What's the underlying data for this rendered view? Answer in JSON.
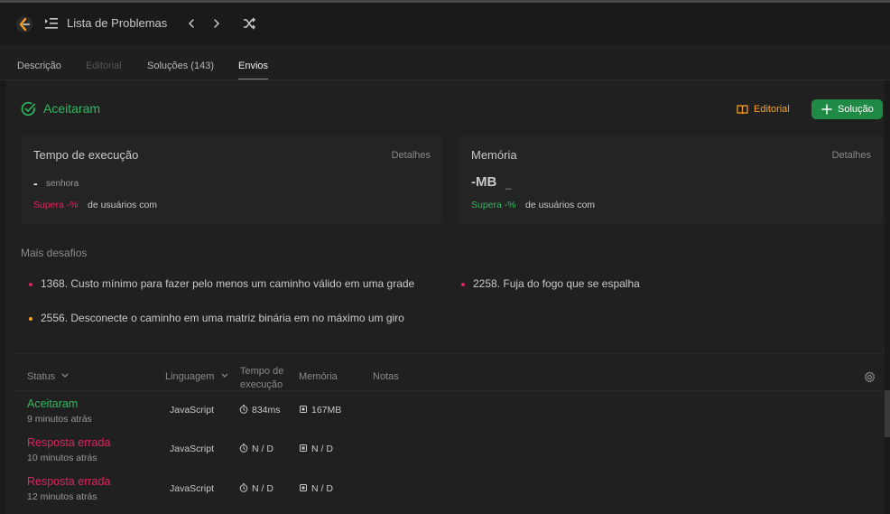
{
  "header": {
    "list_title": "Lista de Problemas",
    "icons": [
      "logo-icon",
      "list-icon",
      "chevron-left-icon",
      "chevron-right-icon",
      "shuffle-icon"
    ]
  },
  "tabs": [
    {
      "label": "Descrição",
      "state": "normal"
    },
    {
      "label": "Editorial",
      "state": "disabled"
    },
    {
      "label": "Soluções (143)",
      "state": "normal"
    },
    {
      "label": "Envios",
      "state": "active"
    }
  ],
  "result": {
    "status": "Aceitaram",
    "editorial_label": "Editorial",
    "solution_label": "Solução"
  },
  "runtime_card": {
    "title": "Tempo de execução",
    "details": "Detalhes",
    "value": "-",
    "unit": "senhora",
    "beats": "Supera -%",
    "users": "de usuários com"
  },
  "memory_card": {
    "title": "Memória",
    "details": "Detalhes",
    "value": "-MB",
    "unit": "_",
    "beats": "Supera -%",
    "users": "de usuários com"
  },
  "more_challenges": {
    "title": "Mais desafios",
    "items": [
      {
        "text": "1368. Custo mínimo para fazer pelo menos um caminho válido em uma grade",
        "difficulty_color": "#e0245e"
      },
      {
        "text": "2258. Fuja do fogo que se espalha",
        "difficulty_color": "#e0245e"
      },
      {
        "text": "2556. Desconecte o caminho em uma matriz binária em no máximo um giro",
        "difficulty_color": "#ffa116"
      }
    ]
  },
  "table": {
    "headers": {
      "status": "Status",
      "language": "Linguagem",
      "runtime_line1": "Tempo de",
      "runtime_line2": "execução",
      "memory": "Memória",
      "notes": "Notas"
    },
    "rows": [
      {
        "status": "Aceitaram",
        "time": "9 minutos atrás",
        "language": "JavaScript",
        "runtime": "834ms",
        "memory": "167MB"
      },
      {
        "status": "Resposta errada",
        "time": "10 minutos atrás",
        "language": "JavaScript",
        "runtime": "N / D",
        "memory": "N / D"
      },
      {
        "status": "Resposta errada",
        "time": "12 minutos atrás",
        "language": "JavaScript",
        "runtime": "N / D",
        "memory": "N / D"
      }
    ]
  },
  "colors": {
    "accepted": "#2cbb5d",
    "wrong": "#e0245e",
    "editorial": "#ffa116",
    "solution_button": "#1f8a46"
  }
}
